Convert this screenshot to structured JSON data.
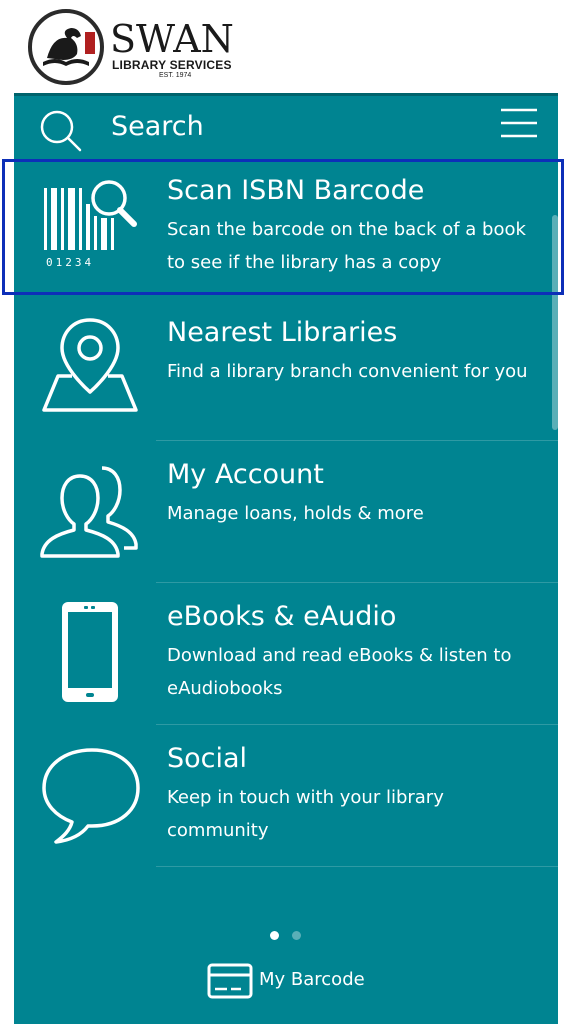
{
  "logo": {
    "name": "SWAN",
    "subtitle": "LIBRARY SERVICES",
    "est": "EST. 1974"
  },
  "search": {
    "label": "Search"
  },
  "menu_items": [
    {
      "title": "Scan ISBN Barcode",
      "description": "Scan the barcode on the back of a book to see if the library has a copy",
      "icon": "barcode-scan-icon",
      "barcode_digits": "01234"
    },
    {
      "title": "Nearest Libraries",
      "description": "Find a library branch convenient for you",
      "icon": "map-pin-icon"
    },
    {
      "title": "My Account",
      "description": "Manage loans, holds & more",
      "icon": "users-icon"
    },
    {
      "title": "eBooks & eAudio",
      "description": "Download and read eBooks & listen to eAudiobooks",
      "icon": "phone-icon"
    },
    {
      "title": "Social",
      "description": "Keep in touch with your library community",
      "icon": "speech-bubble-icon"
    }
  ],
  "pager": {
    "active_page": 1,
    "page_count": 2
  },
  "footer": {
    "barcode_label": "My Barcode"
  },
  "colors": {
    "teal": "#008491",
    "highlight": "#0d2fb8",
    "white": "#ffffff"
  }
}
